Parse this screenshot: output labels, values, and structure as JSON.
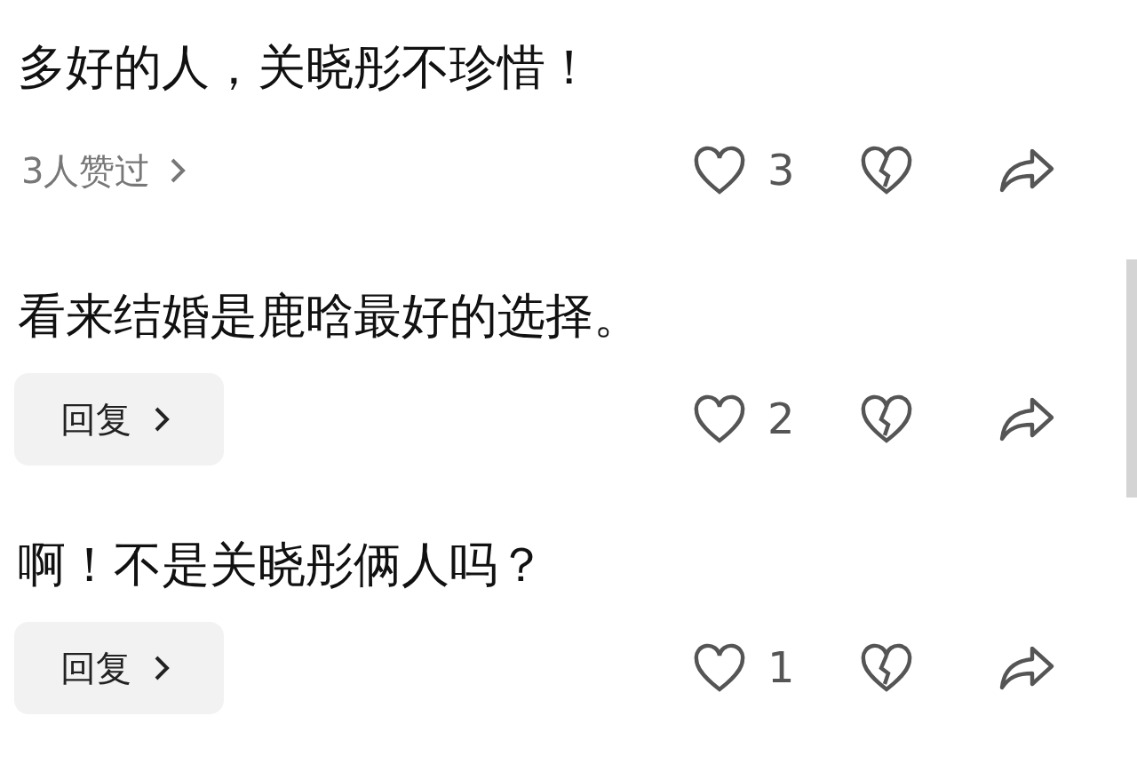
{
  "comments": [
    {
      "text": "多好的人，关晓彤不珍惜！",
      "footer": {
        "kind": "likers",
        "label": "3人赞过"
      },
      "likes": "3"
    },
    {
      "text": "看来结婚是鹿晗最好的选择。",
      "footer": {
        "kind": "reply",
        "label": "回复"
      },
      "likes": "2"
    },
    {
      "text": "啊！不是关晓彤俩人吗？",
      "footer": {
        "kind": "reply",
        "label": "回复"
      },
      "likes": "1"
    }
  ]
}
